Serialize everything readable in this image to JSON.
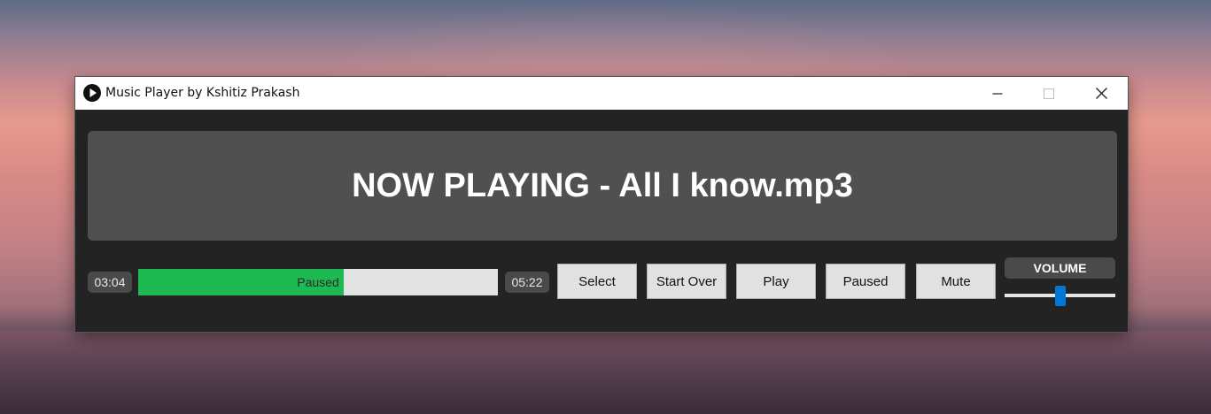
{
  "window": {
    "title": "Music Player by Kshitiz Prakash",
    "app_icon": "play-circle-icon",
    "controls": [
      "minimize-icon",
      "maximize-icon",
      "close-icon"
    ]
  },
  "now_playing": {
    "text": "NOW PLAYING - All I know.mp3"
  },
  "playback": {
    "elapsed": "03:04",
    "total": "05:22",
    "status": "Paused",
    "progress_fraction": 0.571
  },
  "buttons": {
    "select": "Select",
    "start_over": "Start Over",
    "play": "Play",
    "paused": "Paused",
    "mute": "Mute"
  },
  "volume": {
    "label": "VOLUME",
    "level_fraction": 0.5
  },
  "colors": {
    "progress_fill": "#1fb954",
    "slider_thumb": "#0078d7",
    "panel_bg": "#505050",
    "window_bg": "#232323"
  }
}
